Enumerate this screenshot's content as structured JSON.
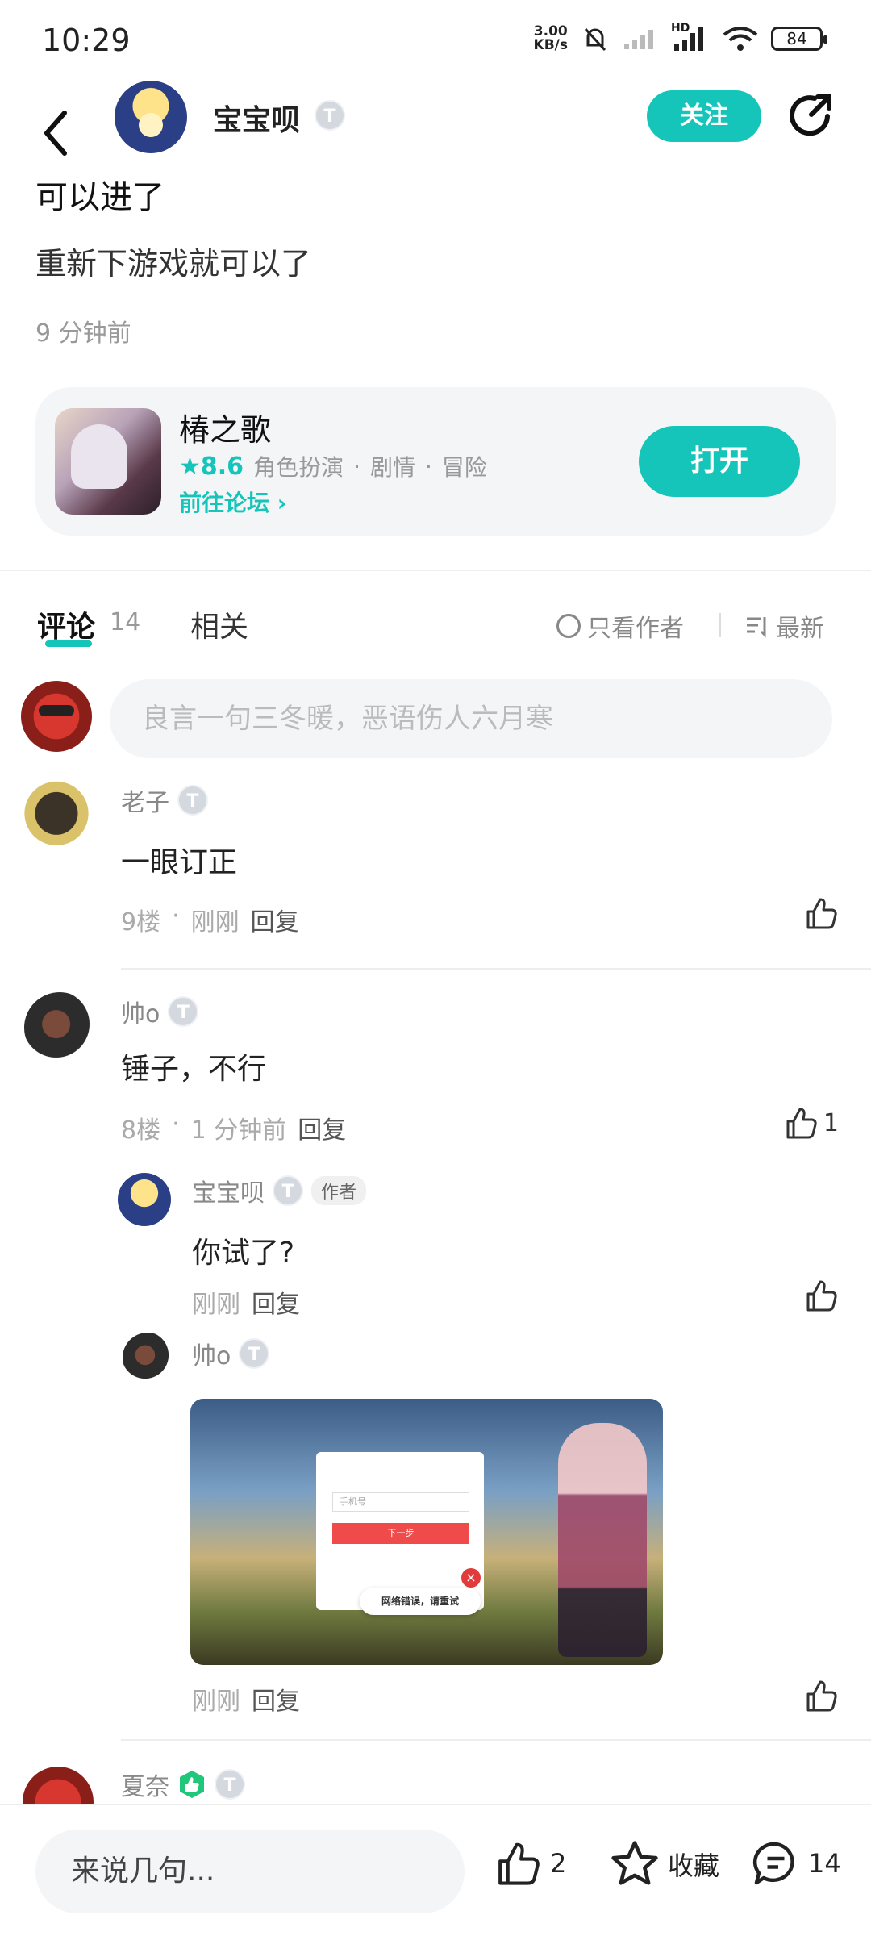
{
  "status": {
    "time": "10:29",
    "net_speed_value": "3.00",
    "net_speed_unit": "KB/s",
    "network_label": "HD",
    "battery": "84"
  },
  "header": {
    "author_name": "宝宝呗",
    "level": "T",
    "follow_label": "关注"
  },
  "post": {
    "title": "可以进了",
    "body": "重新下游戏就可以了",
    "time": "9 分钟前"
  },
  "game": {
    "name": "椿之歌",
    "rating": "8.6",
    "tags": [
      "角色扮演",
      "剧情",
      "冒险"
    ],
    "forum_link": "前往论坛",
    "open_label": "打开"
  },
  "tabs": {
    "comments_label": "评论",
    "comments_count": "14",
    "related_label": "相关",
    "only_author_label": "只看作者",
    "sort_label": "最新"
  },
  "comment_input": {
    "placeholder": "良言一句三冬暖，恶语伤人六月寒"
  },
  "comments": [
    {
      "name": "老子",
      "level": "T",
      "text": "一眼订正",
      "floor": "9楼",
      "time": "刚刚",
      "reply": "回复"
    },
    {
      "name": "帅o",
      "level": "T",
      "text": "锤子，不行",
      "floor": "8楼",
      "time": "1 分钟前",
      "reply": "回复",
      "likes": "1",
      "replies": [
        {
          "name": "宝宝呗",
          "level": "T",
          "tag": "作者",
          "text": "你试了?",
          "time": "刚刚",
          "reply": "回复"
        },
        {
          "name": "帅o",
          "level": "T",
          "time": "刚刚",
          "reply": "回复",
          "image": {
            "field": "手机号",
            "button": "下一步",
            "toast": "网络错误，请重试"
          }
        }
      ]
    },
    {
      "name": "夏奈",
      "level": "T"
    }
  ],
  "bottom_bar": {
    "input_placeholder": "来说几句...",
    "likes": "2",
    "favorite_label": "收藏",
    "comments": "14"
  },
  "colors": {
    "accent": "#15c5b9"
  }
}
